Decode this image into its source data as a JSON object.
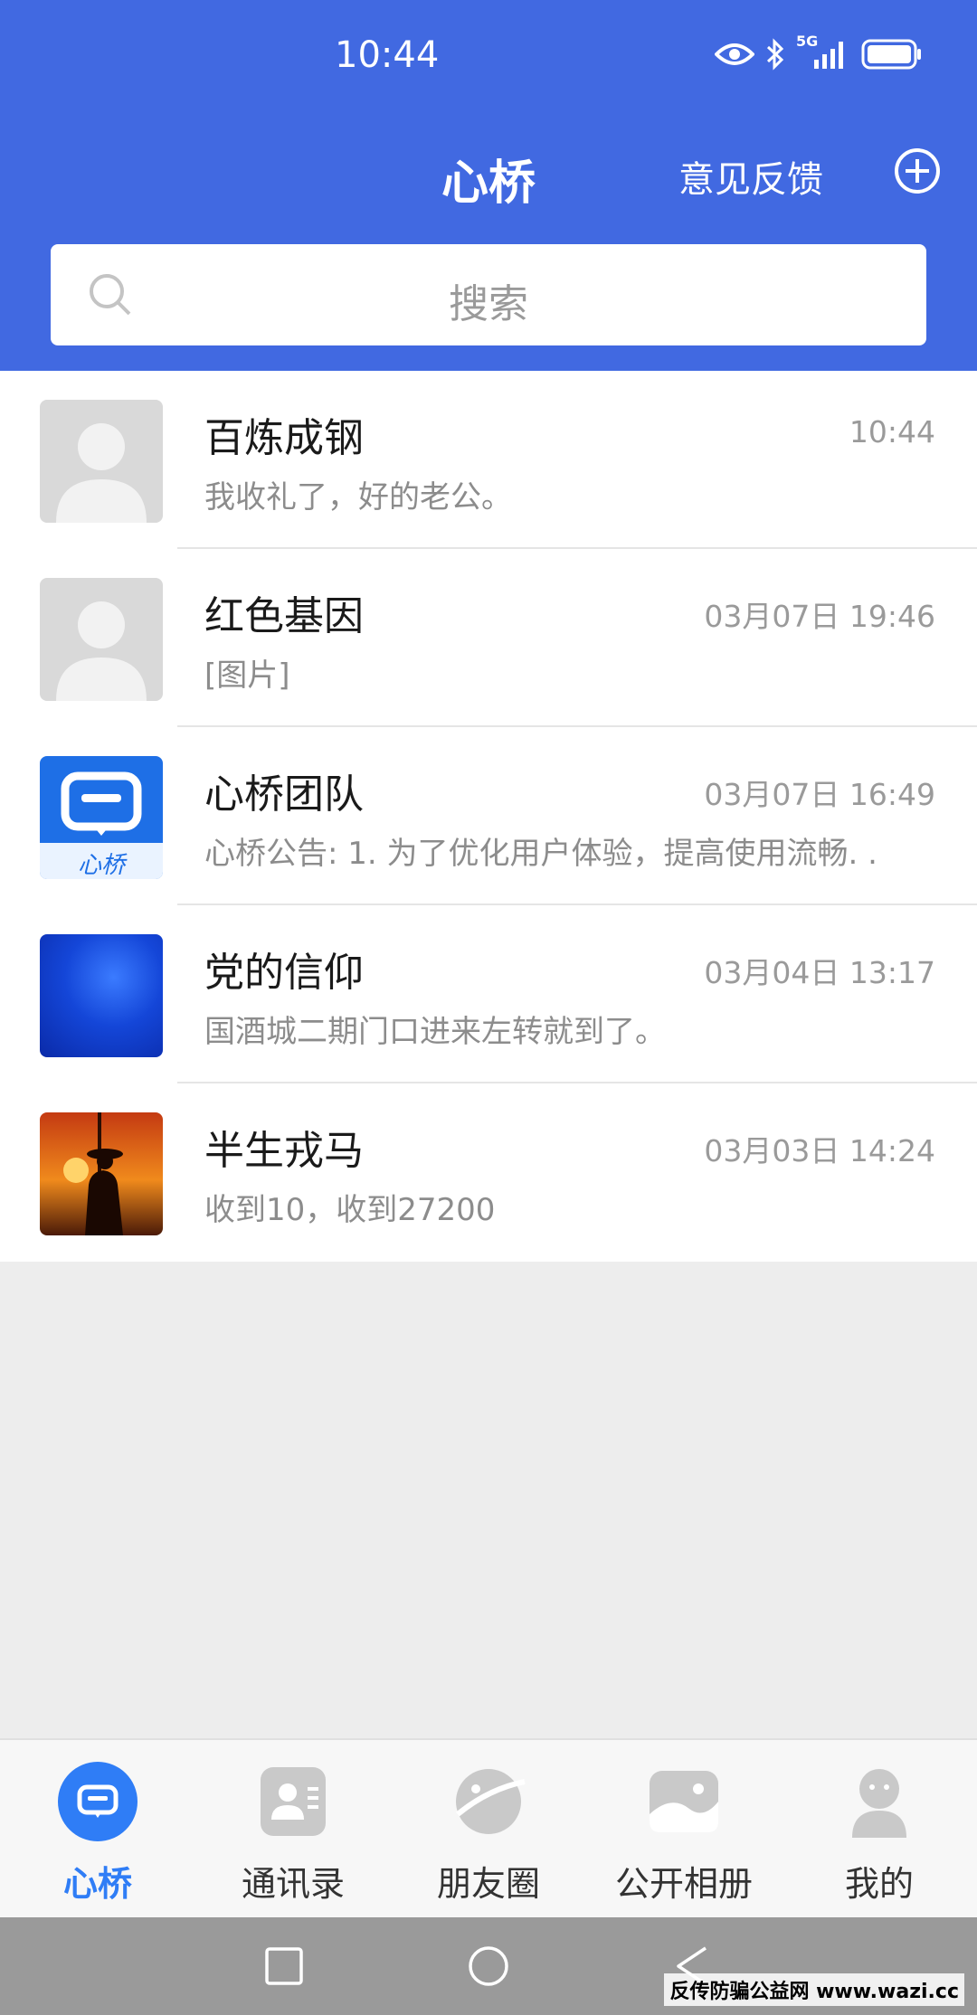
{
  "status_bar": {
    "time": "10:44",
    "network": "5G"
  },
  "header": {
    "title": "心桥",
    "feedback_label": "意见反馈"
  },
  "search": {
    "placeholder": "搜索"
  },
  "chats": [
    {
      "name": "百炼成钢",
      "time": "10:44",
      "preview": "我收礼了，好的老公。",
      "avatar": "default-avatar"
    },
    {
      "name": "红色基因",
      "time": "03月07日 19:46",
      "preview": "[图片]",
      "avatar": "default-avatar"
    },
    {
      "name": "心桥团队",
      "time": "03月07日 16:49",
      "preview": "心桥公告: 1. 为了优化用户体验，提高使用流畅. .",
      "avatar": "app-logo",
      "avatar_text": "心桥"
    },
    {
      "name": "党的信仰",
      "time": "03月04日 13:17",
      "preview": "国酒城二期门口进来左转就到了。",
      "avatar": "blue-image"
    },
    {
      "name": "半生戎马",
      "time": "03月03日 14:24",
      "preview": "收到10，收到27200",
      "avatar": "sunset-soldier-photo"
    }
  ],
  "bottom_nav": [
    {
      "label": "心桥",
      "icon": "chat-icon",
      "active": true
    },
    {
      "label": "通讯录",
      "icon": "contacts-icon",
      "active": false
    },
    {
      "label": "朋友圈",
      "icon": "moments-icon",
      "active": false
    },
    {
      "label": "公开相册",
      "icon": "album-icon",
      "active": false
    },
    {
      "label": "我的",
      "icon": "profile-icon",
      "active": false
    }
  ],
  "watermark": "反传防骗公益网 www.wazi.cc",
  "colors": {
    "header": "#4169e1",
    "active_tab": "#2f7df6",
    "background": "#ededed"
  }
}
